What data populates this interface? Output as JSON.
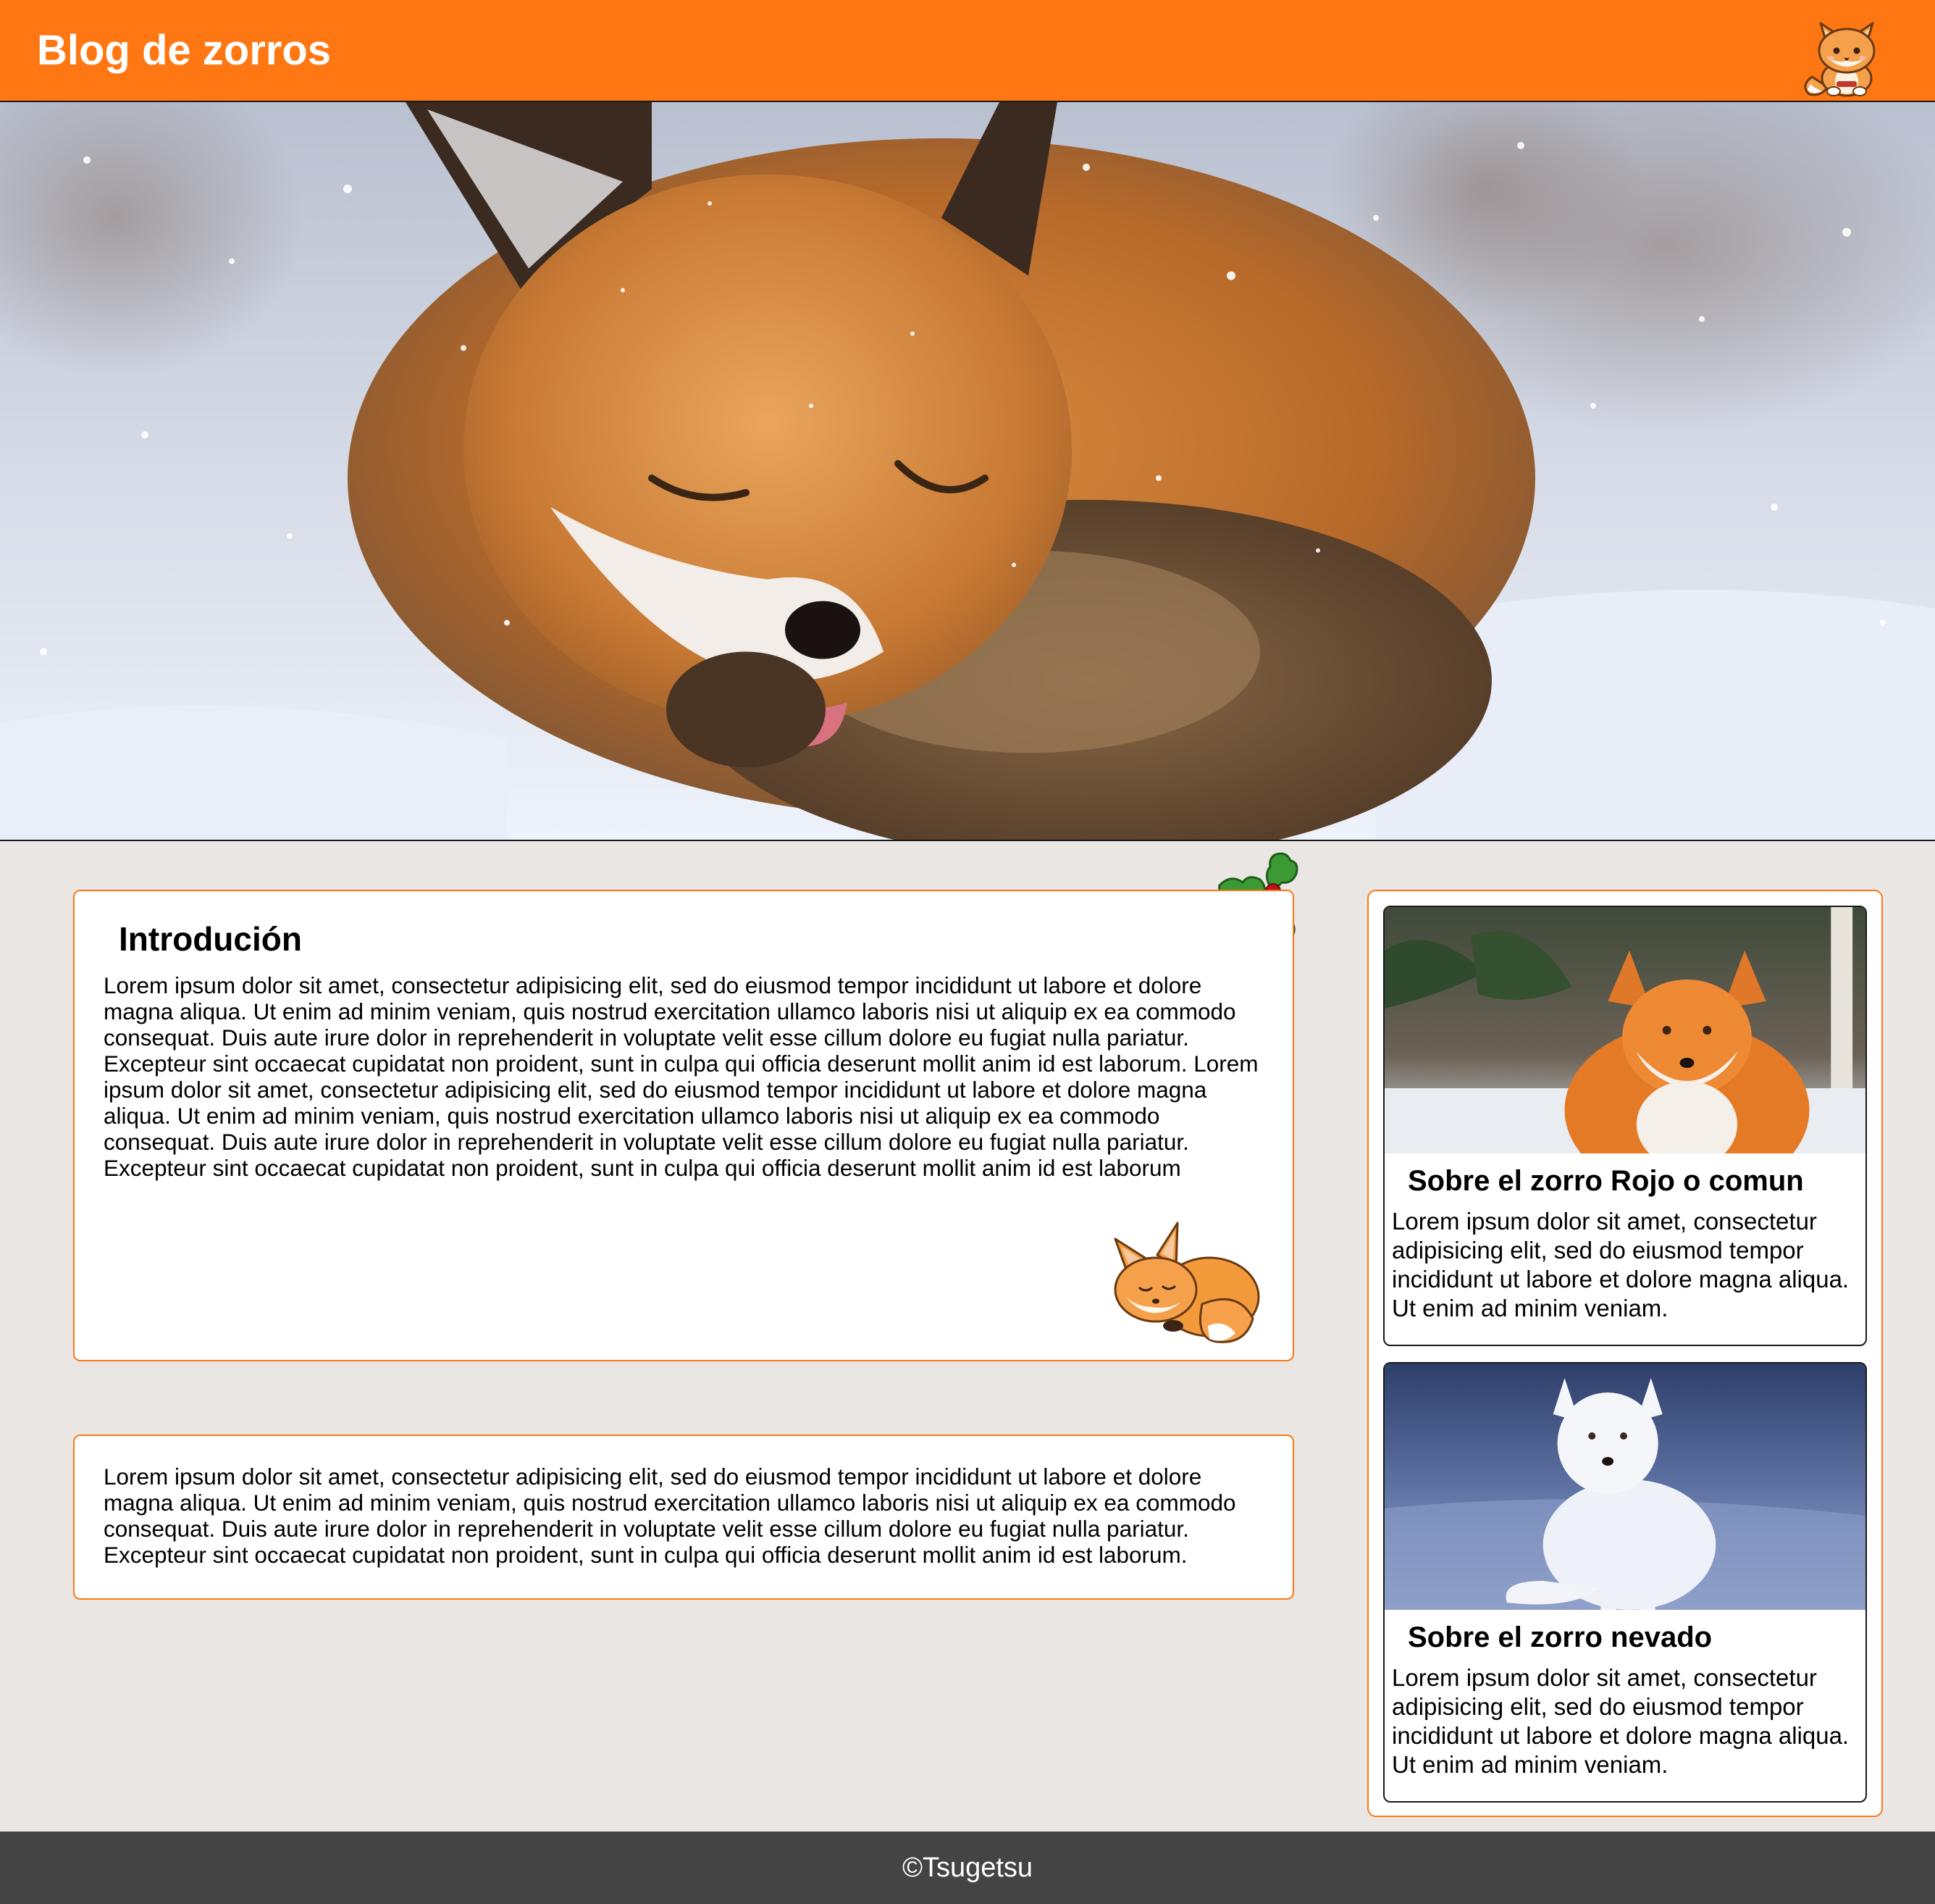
{
  "header": {
    "title": "Blog de zorros",
    "mascot_icon": "fox-mascot-icon",
    "accent_color": "#ff7712"
  },
  "hero": {
    "image": "snow-fox-hero-image"
  },
  "intro": {
    "title": "Introdución",
    "text": "Lorem ipsum dolor sit amet, consectetur adipisicing elit, sed do eiusmod tempor incididunt ut labore et dolore magna aliqua. Ut enim ad minim veniam, quis nostrud exercitation ullamco laboris nisi ut aliquip ex ea commodo consequat. Duis aute irure dolor in reprehenderit in voluptate velit esse cillum dolore eu fugiat nulla pariatur. Excepteur sint occaecat cupidatat non proident, sunt in culpa qui officia deserunt mollit anim id est laborum. Lorem ipsum dolor sit amet, consectetur adipisicing elit, sed do eiusmod tempor incididunt ut labore et dolore magna aliqua. Ut enim ad minim veniam, quis nostrud exercitation ullamco laboris nisi ut aliquip ex ea commodo consequat. Duis aute irure dolor in reprehenderit in voluptate velit esse cillum dolore eu fugiat nulla pariatur. Excepteur sint occaecat cupidatat non proident, sunt in culpa qui officia deserunt mollit anim id est laborum"
  },
  "second": {
    "text": "Lorem ipsum dolor sit amet, consectetur adipisicing elit, sed do eiusmod tempor incididunt ut labore et dolore magna aliqua. Ut enim ad minim veniam, quis nostrud exercitation ullamco laboris nisi ut aliquip ex ea commodo consequat. Duis aute irure dolor in reprehenderit in voluptate velit esse cillum dolore eu fugiat nulla pariatur. Excepteur sint occaecat cupidatat non proident, sunt in culpa qui officia deserunt mollit anim id est laborum."
  },
  "sidebar": {
    "cards": [
      {
        "title": "Sobre el zorro Rojo o comun",
        "text": "Lorem ipsum dolor sit amet, consectetur adipisicing elit, sed do eiusmod tempor incididunt ut labore et dolore magna aliqua. Ut enim ad minim veniam."
      },
      {
        "title": "Sobre el zorro nevado",
        "text": "Lorem ipsum dolor sit amet, consectetur adipisicing elit, sed do eiusmod tempor incididunt ut labore et dolore magna aliqua. Ut enim ad minim veniam."
      }
    ]
  },
  "footer": {
    "text": "©Tsugetsu"
  }
}
